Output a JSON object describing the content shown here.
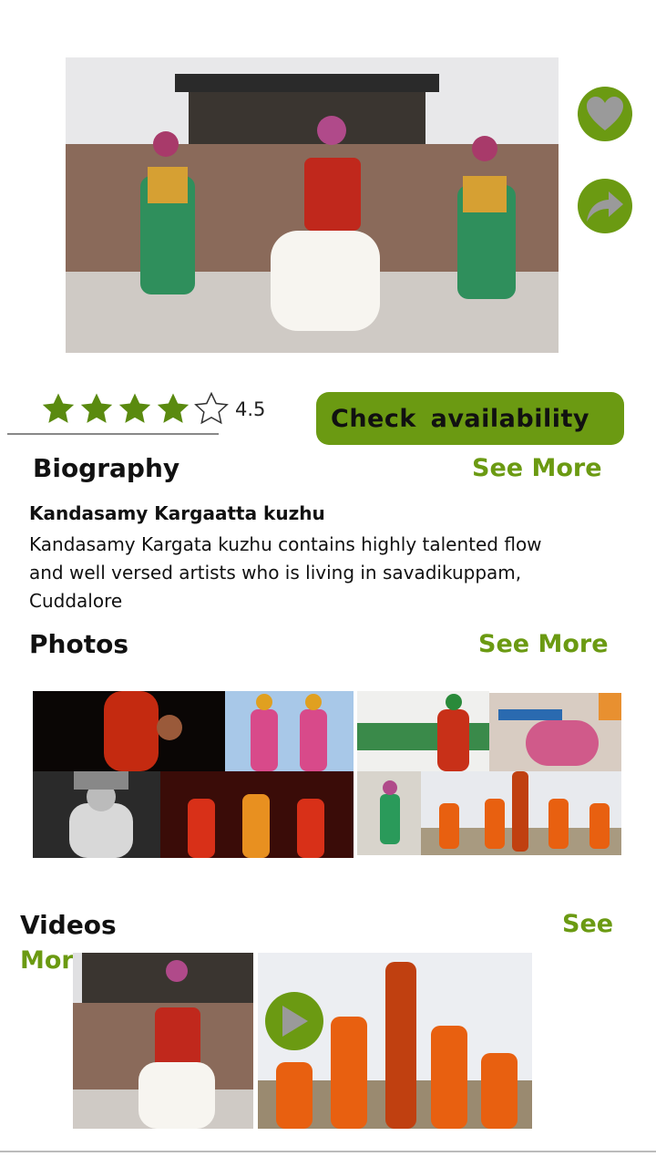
{
  "hero": {
    "image_alt": "Karagattam dancers performing"
  },
  "actions": {
    "like_icon": "heart-icon",
    "share_icon": "share-arrow-icon"
  },
  "rating": {
    "value": "4.5",
    "stars_filled": 4,
    "stars_total": 5
  },
  "check_button": {
    "label": "Check  availability"
  },
  "biography": {
    "title": "Biography",
    "see_more": "See More",
    "artist_name": "Kandasamy Kargaatta kuzhu",
    "lines": [
      "Kandasamy  Kargata kuzhu contains  highly talented flow",
      "and well  versed artists who is living in savadikuppam,",
      "Cuddalore"
    ]
  },
  "photos": {
    "title": "Photos",
    "see_more": "See More"
  },
  "videos": {
    "title": "Videos",
    "see_more_1": "See",
    "see_more_2": "More"
  },
  "colors": {
    "accent": "#6b9a12",
    "star": "#5a8a0f"
  }
}
